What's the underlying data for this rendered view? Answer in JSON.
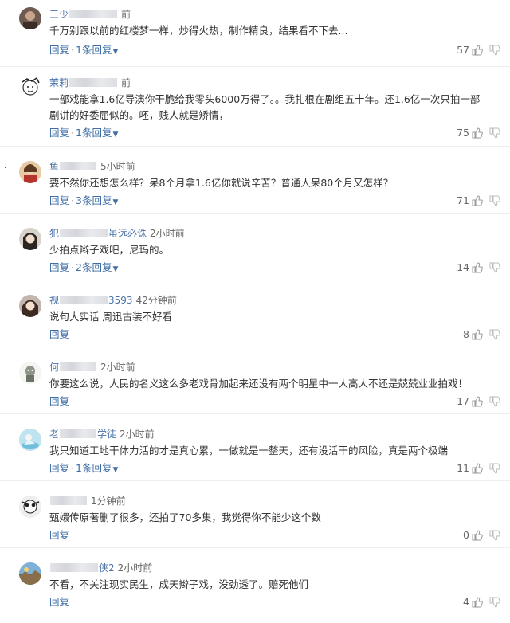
{
  "comments": [
    {
      "name_pre": "三少",
      "name_post": "",
      "time": "前",
      "text": "千万别跟以前的红楼梦一样，炒得火热，制作精良，结果看不下去...",
      "reply_label": "回复",
      "replies_label": "1条回复",
      "likes": "57"
    },
    {
      "name_pre": "茉莉",
      "name_post": "",
      "time": "前",
      "text": "一部戏能拿1.6亿导演你干脆给我零头6000万得了。。我扎根在剧组五十年。还1.6亿一次只拍一部剧讲的好委屈似的。呸，贱人就是矫情，",
      "reply_label": "回复",
      "replies_label": "1条回复",
      "likes": "75"
    },
    {
      "name_pre": "鱼",
      "name_post": "",
      "time": "5小时前",
      "text": "要不然你还想怎么样？呆8个月拿1.6亿你就说辛苦？普通人呆80个月又怎样？",
      "reply_label": "回复",
      "replies_label": "3条回复",
      "likes": "71"
    },
    {
      "name_pre": "犯",
      "name_post": "虽远必诛",
      "time": "2小时前",
      "text": "少拍点辫子戏吧，尼玛的。",
      "reply_label": "回复",
      "replies_label": "2条回复",
      "likes": "14"
    },
    {
      "name_pre": "视",
      "name_post": "3593",
      "time": "42分钟前",
      "text": "说句大实话 周迅古装不好看",
      "reply_label": "回复",
      "replies_label": "",
      "likes": "8"
    },
    {
      "name_pre": "何",
      "name_post": "",
      "time": "2小时前",
      "text": "你要这么说，人民的名义这么多老戏骨加起来还没有两个明星中一人高人不还是兢兢业业拍戏！",
      "reply_label": "回复",
      "replies_label": "",
      "likes": "17"
    },
    {
      "name_pre": "老",
      "name_post": "学徒",
      "time": "2小时前",
      "text": "我只知道工地干体力活的才是真心累，一做就是一整天，还有没活干的风险，真是两个极端",
      "reply_label": "回复",
      "replies_label": "1条回复",
      "likes": "11"
    },
    {
      "name_pre": "",
      "name_post": "",
      "time": "1分钟前",
      "text": "甄嬛传原著删了很多，还拍了70多集，我觉得你不能少这个数",
      "reply_label": "回复",
      "replies_label": "",
      "likes": "0"
    },
    {
      "name_pre": "",
      "name_post": "侠2",
      "time": "2小时前",
      "text": "不看，不关注现实民生，成天辫子戏，没劲透了。赔死他们",
      "reply_label": "回复",
      "replies_label": "",
      "likes": "4"
    }
  ],
  "icons": {
    "like": "thumb-up-icon",
    "dislike": "thumb-down-icon",
    "replies_arrow": "triangle-down-icon"
  },
  "colors": {
    "link": "#3f6ea5",
    "username": "#4a72a8",
    "text": "#333333",
    "divider": "#eeeeee"
  }
}
